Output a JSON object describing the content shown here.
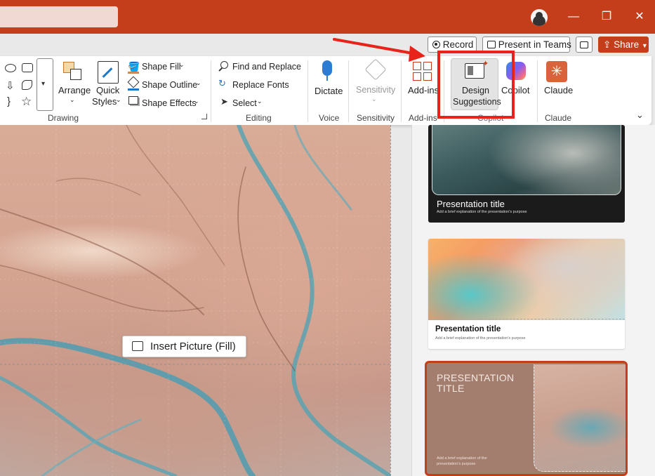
{
  "titlebar": {
    "minimize": "—",
    "restore": "❐",
    "close": "✕"
  },
  "actions": {
    "record": "Record",
    "present_teams": "Present in Teams",
    "share": "Share"
  },
  "ribbon": {
    "drawing": {
      "arrange": "Arrange",
      "quick": "Quick",
      "styles": "Styles",
      "shape_fill": "Shape Fill",
      "shape_outline": "Shape Outline",
      "shape_effects": "Shape Effects",
      "label": "Drawing"
    },
    "editing": {
      "find_replace": "Find and Replace",
      "replace_fonts": "Replace Fonts",
      "select": "Select",
      "label": "Editing"
    },
    "voice": {
      "dictate": "Dictate",
      "label": "Voice"
    },
    "sensitivity": {
      "button": "Sensitivity",
      "label": "Sensitivity"
    },
    "addins": {
      "button": "Add-ins",
      "label": "Add-ins"
    },
    "copilot": {
      "design_line1": "Design",
      "design_line2": "Suggestions",
      "copilot": "Copilot",
      "label": "Copilot"
    },
    "claude": {
      "button": "Claude",
      "label": "Claude"
    }
  },
  "slide": {
    "insert_picture": "Insert Picture (Fill)"
  },
  "designer": {
    "card1_title": "Presentation title",
    "card1_sub": "Add a brief explanation of the presentation's purpose",
    "card2_title": "Presentation title",
    "card2_sub": "Add a brief explanation of the presentation's purpose",
    "card3_title_line1": "PRESENTATION",
    "card3_title_line2": "TITLE",
    "card3_sub_line1": "Add a brief explanation of the",
    "card3_sub_line2": "presentation's purpose"
  },
  "colors": {
    "accent": "#c43e1c",
    "annotation": "#e8231a"
  }
}
